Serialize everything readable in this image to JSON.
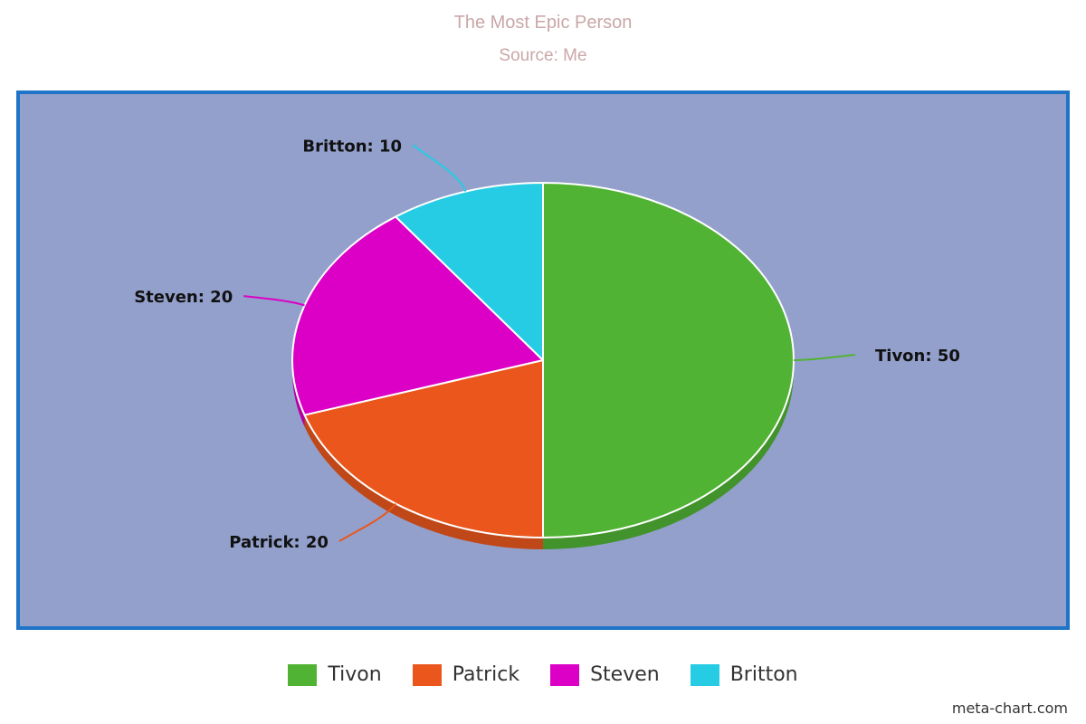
{
  "chart_data": {
    "type": "pie",
    "title": "The Most Epic Person",
    "subtitle": "Source: Me",
    "categories": [
      "Tivon",
      "Patrick",
      "Steven",
      "Britton"
    ],
    "values": [
      50,
      20,
      20,
      10
    ],
    "data_labels": [
      "Tivon: 50",
      "Patrick: 20",
      "Steven: 20",
      "Britton: 10"
    ],
    "colors": [
      "#51b334",
      "#ea561c",
      "#dc00c6",
      "#25cce4"
    ],
    "legend_position": "bottom",
    "plot_background": "#92a0cb",
    "plot_border": "#1f74c7"
  },
  "credit": "meta-chart.com"
}
